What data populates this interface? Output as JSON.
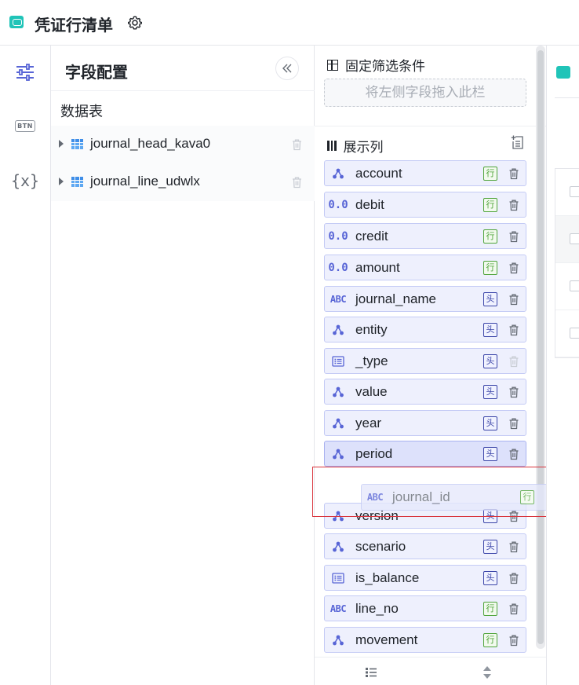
{
  "header": {
    "title": "凭证行清单",
    "settings_icon": "gear-icon"
  },
  "rail": {
    "items": [
      {
        "name": "sliders-icon",
        "active": true
      },
      {
        "name": "btn-icon",
        "label": "BTN"
      },
      {
        "name": "variable-icon",
        "label": "{x}"
      }
    ],
    "accent": "#5865d6"
  },
  "field_panel": {
    "title": "字段配置",
    "collapse_icon": "double-chevron-left-icon",
    "tables_label": "数据表",
    "tables": [
      {
        "label": "journal_head_kava0"
      },
      {
        "label": "journal_line_udwlx"
      }
    ]
  },
  "column_panel": {
    "fixed_filter": {
      "title": "固定筛选条件",
      "placeholder": "将左侧字段拖入此栏"
    },
    "display_columns": {
      "title": "展示列",
      "fields": [
        {
          "type": "dimension",
          "type_label": "",
          "name": "account",
          "tag": "行",
          "tag_kind": "line"
        },
        {
          "type": "number",
          "type_label": "0.0",
          "name": "debit",
          "tag": "行",
          "tag_kind": "line"
        },
        {
          "type": "number",
          "type_label": "0.0",
          "name": "credit",
          "tag": "行",
          "tag_kind": "line"
        },
        {
          "type": "number",
          "type_label": "0.0",
          "name": "amount",
          "tag": "行",
          "tag_kind": "line"
        },
        {
          "type": "text",
          "type_label": "ABC",
          "name": "journal_name",
          "tag": "头",
          "tag_kind": "head"
        },
        {
          "type": "dimension",
          "type_label": "",
          "name": "entity",
          "tag": "头",
          "tag_kind": "head"
        },
        {
          "type": "list",
          "type_label": "",
          "name": "_type",
          "tag": "头",
          "tag_kind": "head",
          "trash_disabled": true
        },
        {
          "type": "dimension",
          "type_label": "",
          "name": "value",
          "tag": "头",
          "tag_kind": "head"
        },
        {
          "type": "dimension",
          "type_label": "",
          "name": "year",
          "tag": "头",
          "tag_kind": "head"
        },
        {
          "type": "dimension",
          "type_label": "",
          "name": "period",
          "tag": "头",
          "tag_kind": "head",
          "active": true
        },
        {
          "type": "dimension",
          "type_label": "",
          "name": "version",
          "tag": "头",
          "tag_kind": "head"
        },
        {
          "type": "dimension",
          "type_label": "",
          "name": "scenario",
          "tag": "头",
          "tag_kind": "head"
        },
        {
          "type": "list",
          "type_label": "",
          "name": "is_balance",
          "tag": "头",
          "tag_kind": "head"
        },
        {
          "type": "text",
          "type_label": "ABC",
          "name": "line_no",
          "tag": "行",
          "tag_kind": "line"
        },
        {
          "type": "dimension",
          "type_label": "",
          "name": "movement",
          "tag": "行",
          "tag_kind": "line"
        }
      ]
    },
    "drag_ghost": {
      "type_label": "ABC",
      "name": "journal_id",
      "tag": "行"
    }
  }
}
